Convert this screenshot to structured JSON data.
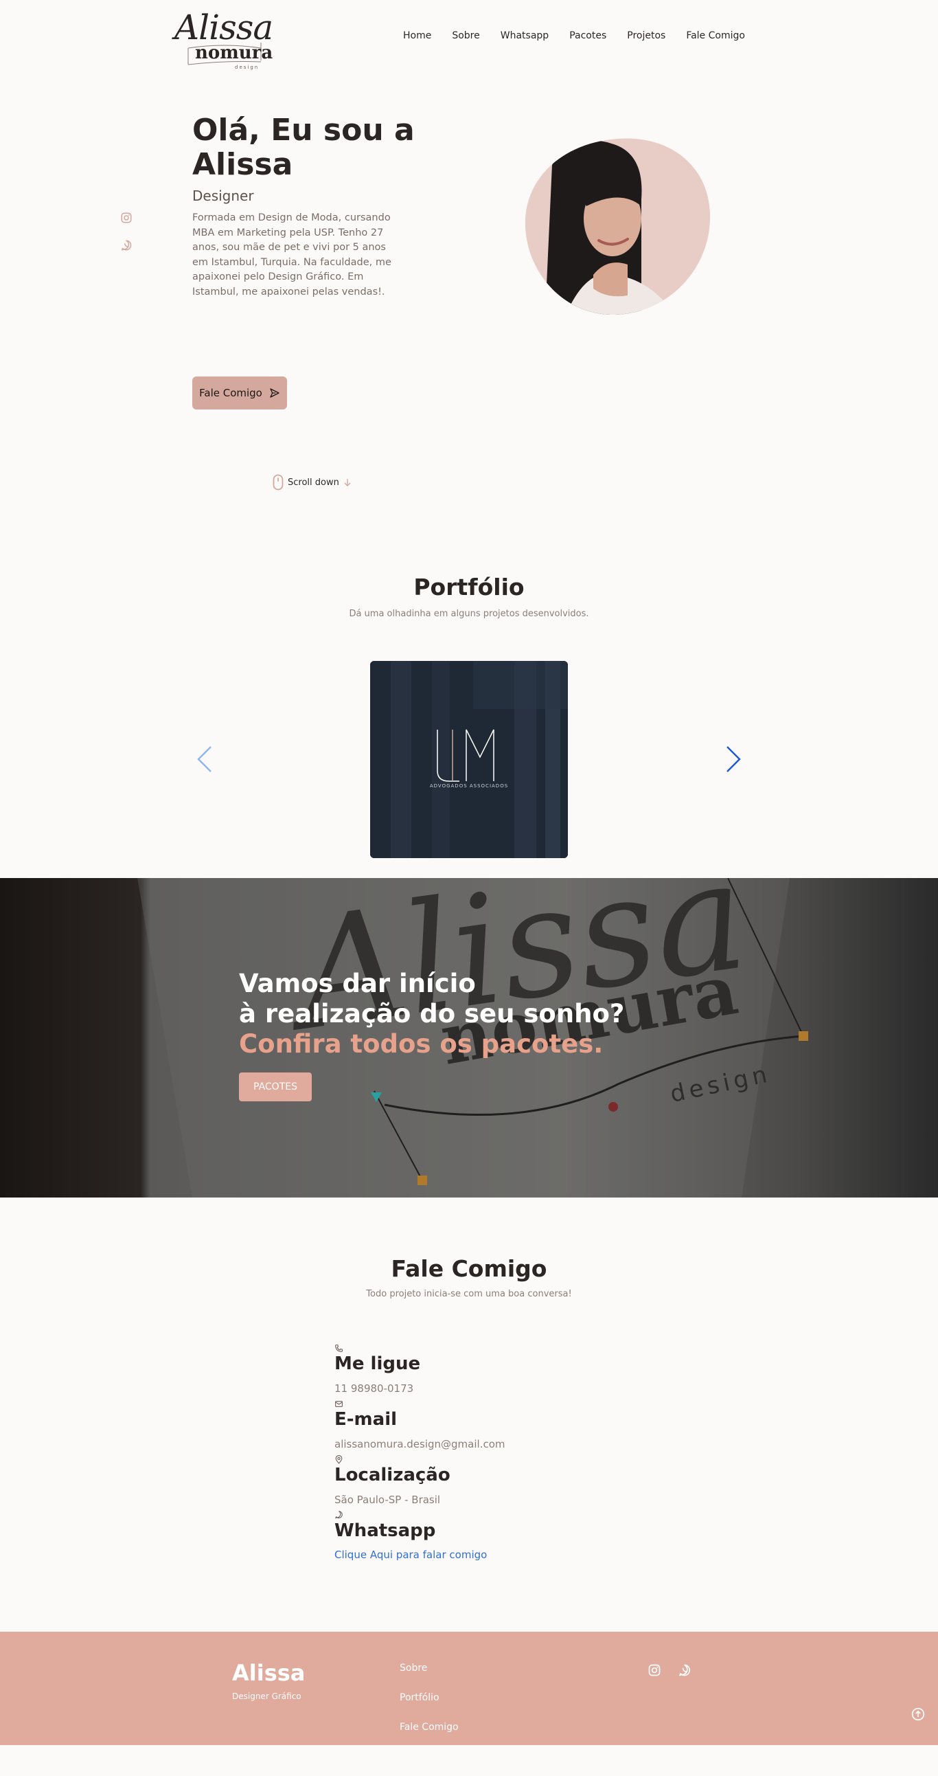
{
  "header": {
    "logo": {
      "script": "Alissa",
      "brand": "nomura",
      "tag": "design"
    },
    "nav": [
      "Home",
      "Sobre",
      "Whatsapp",
      "Pacotes",
      "Projetos",
      "Fale Comigo"
    ]
  },
  "hero": {
    "title": "Olá, Eu sou a Alissa",
    "role": "Designer",
    "description": "Formada em Design de Moda, cursando MBA em Marketing pela USP. Tenho 27 anos, sou mãe de pet e vivi por 5 anos em Istambul, Turquia. Na faculdade, me apaixonei pelo Design Gráfico. Em Istambul, me apaixonei pelas vendas!.",
    "cta_label": "Fale Comigo",
    "scroll_label": "Scroll down",
    "social_icons": [
      "instagram-icon",
      "whatsapp-icon"
    ]
  },
  "portfolio": {
    "title": "Portfólio",
    "subtitle": "Dá uma olhadinha em alguns projetos desenvolvidos.",
    "project": {
      "logo": "JM",
      "caption": "ADVOGADOS ASSOCIADOS"
    }
  },
  "banner": {
    "line1": "Vamos dar início",
    "line2": "à realização do seu sonho?",
    "line3": "Confira todos os pacotes.",
    "button_label": "PACOTES",
    "bg_script": "Alissa",
    "bg_brand": "nomura",
    "bg_tag": "design"
  },
  "contact": {
    "title": "Fale Comigo",
    "subtitle": "Todo projeto inicia-se com uma boa conversa!",
    "items": [
      {
        "icon": "phone-icon",
        "label": "Me ligue",
        "value": "11 98980-0173"
      },
      {
        "icon": "mail-icon",
        "label": "E-mail",
        "value": "alissanomura.design@gmail.com"
      },
      {
        "icon": "location-icon",
        "label": "Localização",
        "value": "São Paulo-SP - Brasil"
      },
      {
        "icon": "whatsapp-icon",
        "label": "Whatsapp",
        "value": "Clique Aqui para falar comigo"
      }
    ]
  },
  "footer": {
    "brand": "Alissa",
    "tagline": "Designer Gráfico",
    "links": [
      "Sobre",
      "Portfólio",
      "Fale Comigo"
    ]
  },
  "colors": {
    "accent": "#d4a89c",
    "footer_bg": "#e0aa9d",
    "highlight": "#e8a28c",
    "link": "#2f6fd6",
    "page_bg": "#fcfaf8"
  }
}
